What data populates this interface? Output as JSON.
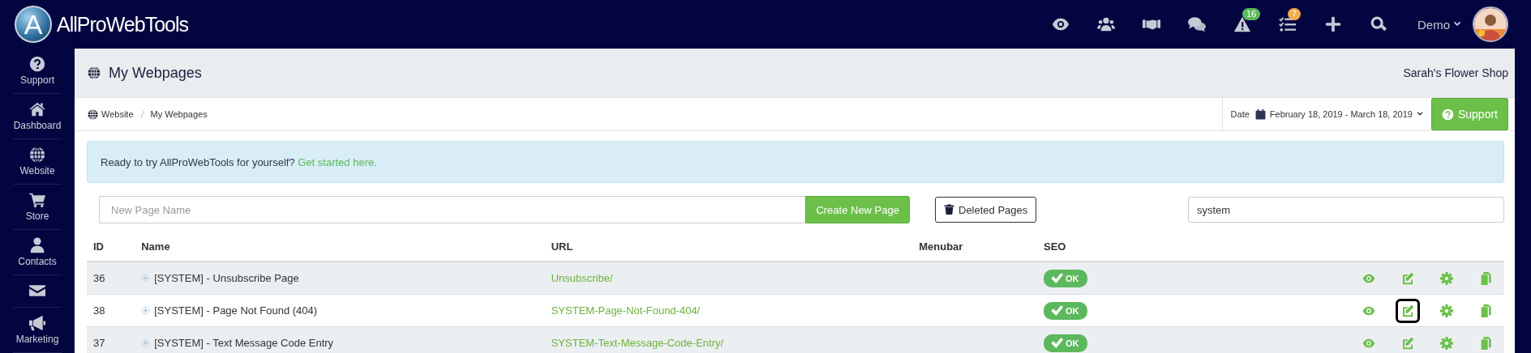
{
  "topbar": {
    "logo_letter": "A",
    "brand": "AllProWebTools",
    "icons": [
      {
        "kind": "eye"
      },
      {
        "kind": "users"
      },
      {
        "kind": "handshake"
      },
      {
        "kind": "chat"
      },
      {
        "kind": "alert",
        "badge": "16",
        "color": "#5cb85c"
      },
      {
        "kind": "tasks",
        "badge": "7",
        "color": "#f0ad4e"
      },
      {
        "kind": "plus"
      },
      {
        "kind": "search"
      }
    ],
    "user": "Demo"
  },
  "sidebar": {
    "items": [
      {
        "kind": "support",
        "label": "Support"
      },
      {
        "kind": "home",
        "label": "Dashboard"
      },
      {
        "kind": "globe",
        "label": "Website"
      },
      {
        "kind": "cart",
        "label": "Store"
      },
      {
        "kind": "person",
        "label": "Contacts"
      },
      {
        "kind": "mail"
      },
      {
        "kind": "megaphone",
        "label": "Marketing"
      }
    ]
  },
  "header": {
    "title": "My Webpages",
    "shop": "Sarah's Flower Shop"
  },
  "breadcrumb": [
    "Website",
    "My Webpages"
  ],
  "date": {
    "label": "Date",
    "range": "February 18, 2019 - March 18, 2019"
  },
  "support_button": "Support",
  "alert": {
    "text": "Ready to try AllProWebTools for yourself?",
    "link": "Get started here."
  },
  "new_page": {
    "placeholder": "New Page Name",
    "button": "Create New Page"
  },
  "deleted_button": "Deleted Pages",
  "search": {
    "value": "system"
  },
  "table": {
    "columns": [
      "ID",
      "Name",
      "URL",
      "Menubar",
      "SEO"
    ],
    "rows": [
      {
        "id": "36",
        "name": "[SYSTEM] - Unsubscribe Page",
        "url": "Unsubscribe/",
        "seo": "OK",
        "actions": [
          {
            "kind": "view",
            "focused": false
          },
          {
            "kind": "edit",
            "focused": false
          },
          {
            "kind": "settings",
            "focused": false
          },
          {
            "kind": "copy",
            "focused": false
          }
        ]
      },
      {
        "id": "38",
        "name": "[SYSTEM] - Page Not Found (404)",
        "url": "SYSTEM-Page-Not-Found-404/",
        "seo": "OK",
        "actions": [
          {
            "kind": "view",
            "focused": false
          },
          {
            "kind": "edit",
            "focused": true
          },
          {
            "kind": "settings",
            "focused": false
          },
          {
            "kind": "copy",
            "focused": false
          }
        ]
      },
      {
        "id": "37",
        "name": "[SYSTEM] - Text Message Code Entry",
        "url": "SYSTEM-Text-Message-Code-Entry/",
        "seo": "OK",
        "actions": [
          {
            "kind": "view",
            "focused": false
          },
          {
            "kind": "edit",
            "focused": false
          },
          {
            "kind": "settings",
            "focused": false
          },
          {
            "kind": "copy",
            "focused": false
          }
        ]
      }
    ]
  }
}
